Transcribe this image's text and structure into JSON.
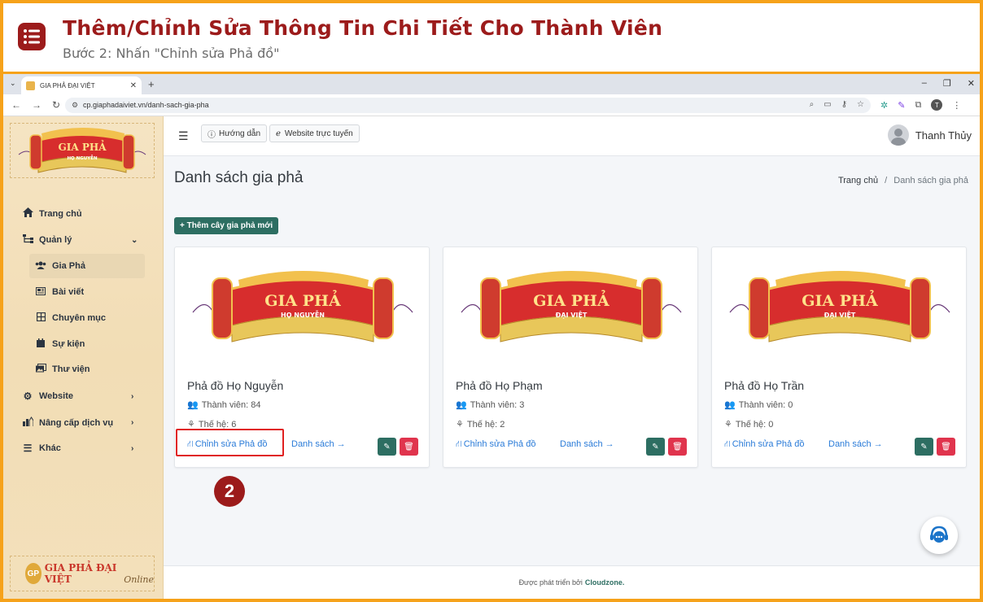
{
  "guide": {
    "title": "Thêm/Chỉnh Sửa Thông Tin Chi Tiết Cho Thành Viên",
    "subtitle": "Bước 2: Nhấn \"Chỉnh sửa Phả đồ\"",
    "step_number": "2",
    "accent_color": "#9c1b1b",
    "frame_color": "#f6a21a"
  },
  "browser": {
    "tab_title": "GIA PHẢ ĐẠI VIỆT",
    "url": "cp.giaphadaiviet.vn/danh-sach-gia-pha",
    "profile_initial": "T"
  },
  "sidebar": {
    "logo_title": "GIA PHẢ",
    "logo_sub": "HỌ NGUYỄN",
    "items": [
      {
        "label": "Trang chủ",
        "icon": "home-icon"
      },
      {
        "label": "Quản lý",
        "icon": "sitemap-icon"
      },
      {
        "label": "Gia Phả",
        "icon": "users-icon"
      },
      {
        "label": "Bài viết",
        "icon": "newspaper-icon"
      },
      {
        "label": "Chuyên mục",
        "icon": "grid-icon"
      },
      {
        "label": "Sự kiện",
        "icon": "calendar-icon"
      },
      {
        "label": "Thư viện",
        "icon": "images-icon"
      },
      {
        "label": "Website",
        "icon": "gear-icon"
      },
      {
        "label": "Nâng cấp dịch vụ",
        "icon": "upgrade-icon"
      },
      {
        "label": "Khác",
        "icon": "list-icon"
      }
    ],
    "brand_badge": "GP",
    "brand_name": "GIA PHẢ ĐẠI VIỆT",
    "brand_suffix": "Online"
  },
  "topnav": {
    "guide_btn": "Hướng dẫn",
    "website_btn": "Website trực tuyến",
    "user_name": "Thanh Thủy"
  },
  "page": {
    "title": "Danh sách gia phả",
    "breadcrumb_home": "Trang chủ",
    "breadcrumb_sep": "/",
    "breadcrumb_current": "Danh sách gia phả",
    "add_button": "+ Thêm cây gia phả mới"
  },
  "cards": [
    {
      "banner_title": "GIA PHẢ",
      "banner_sub": "HỌ NGUYỄN",
      "name": "Phả đồ Họ Nguyễn",
      "members": "Thành viên: 84",
      "generations": "Thế hệ: 6",
      "edit_link": "Chỉnh sửa Phả đồ",
      "list_link": "Danh sách →"
    },
    {
      "banner_title": "GIA PHẢ",
      "banner_sub": "ĐẠI VIỆT",
      "name": "Phả đồ Họ Phạm",
      "members": "Thành viên: 3",
      "generations": "Thế hệ: 2",
      "edit_link": "Chỉnh sửa Phả đồ",
      "list_link": "Danh sách →"
    },
    {
      "banner_title": "GIA PHẢ",
      "banner_sub": "ĐẠI VIỆT",
      "name": "Phả đồ Họ Trần",
      "members": "Thành viên: 0",
      "generations": "Thế hệ: 0",
      "edit_link": "Chỉnh sửa Phả đồ",
      "list_link": "Danh sách →"
    }
  ],
  "footer": {
    "text": "Được phát triển bởi",
    "brand": "Cloudzone."
  }
}
